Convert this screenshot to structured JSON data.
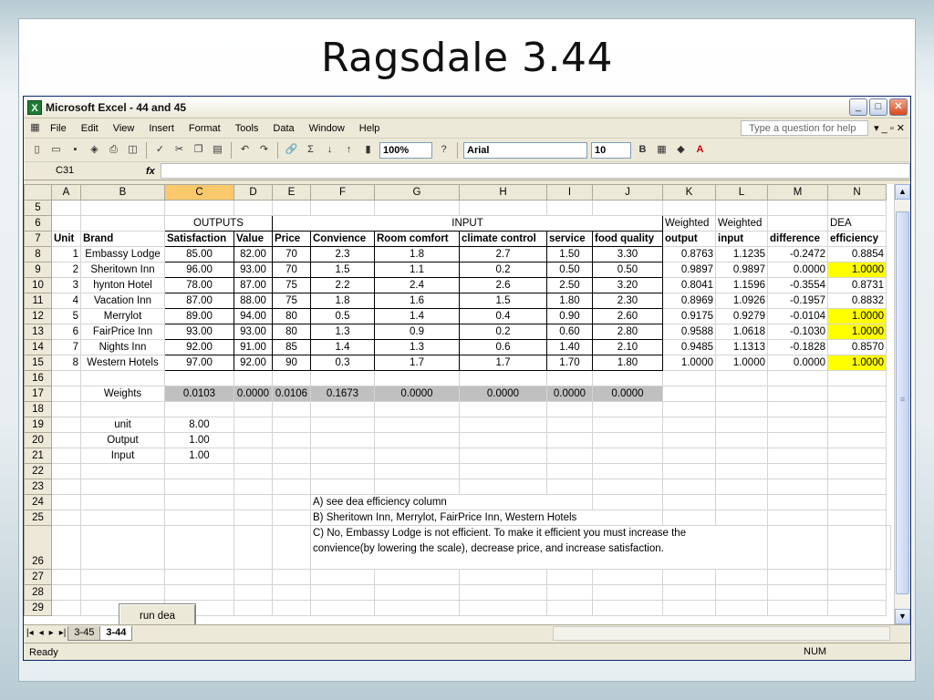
{
  "slide": {
    "title": "Ragsdale 3.44"
  },
  "window": {
    "title": "Microsoft Excel - 44 and 45"
  },
  "menu": [
    "File",
    "Edit",
    "View",
    "Insert",
    "Format",
    "Tools",
    "Data",
    "Window",
    "Help"
  ],
  "question_box": "Type a question for help",
  "toolbar": {
    "zoom": "100%",
    "font": "Arial",
    "font_size": "10"
  },
  "formula_bar": {
    "cell_ref": "C31",
    "fx": "fx",
    "formula": ""
  },
  "columns": [
    "A",
    "B",
    "C",
    "D",
    "E",
    "F",
    "G",
    "H",
    "I",
    "J",
    "K",
    "L",
    "M",
    "N"
  ],
  "rows": {
    "r5": {
      "n": "5"
    },
    "r6": {
      "n": "6",
      "outputs": "OUTPUTS",
      "input": "INPUT",
      "k": "Weighted",
      "l": "Weighted",
      "n_dea": "DEA"
    },
    "r7": {
      "n": "7",
      "cells": [
        "Unit",
        "Brand",
        "Satisfaction",
        "Value",
        "Price",
        "Convience",
        "Room comfort",
        "climate control",
        "service",
        "food quality",
        "output",
        "input",
        "difference",
        "efficiency"
      ]
    },
    "r8": {
      "n": "8",
      "cells": [
        "1",
        "Embassy Lodge",
        "85.00",
        "82.00",
        "70",
        "2.3",
        "1.8",
        "2.7",
        "1.50",
        "3.30",
        "0.8763",
        "1.1235",
        "-0.2472",
        "0.8854"
      ]
    },
    "r9": {
      "n": "9",
      "cells": [
        "2",
        "Sheritown Inn",
        "96.00",
        "93.00",
        "70",
        "1.5",
        "1.1",
        "0.2",
        "0.50",
        "0.50",
        "0.9897",
        "0.9897",
        "0.0000",
        "1.0000"
      ]
    },
    "r10": {
      "n": "10",
      "cells": [
        "3",
        "hynton Hotel",
        "78.00",
        "87.00",
        "75",
        "2.2",
        "2.4",
        "2.6",
        "2.50",
        "3.20",
        "0.8041",
        "1.1596",
        "-0.3554",
        "0.8731"
      ]
    },
    "r11": {
      "n": "11",
      "cells": [
        "4",
        "Vacation Inn",
        "87.00",
        "88.00",
        "75",
        "1.8",
        "1.6",
        "1.5",
        "1.80",
        "2.30",
        "0.8969",
        "1.0926",
        "-0.1957",
        "0.8832"
      ]
    },
    "r12": {
      "n": "12",
      "cells": [
        "5",
        "Merrylot",
        "89.00",
        "94.00",
        "80",
        "0.5",
        "1.4",
        "0.4",
        "0.90",
        "2.60",
        "0.9175",
        "0.9279",
        "-0.0104",
        "1.0000"
      ]
    },
    "r13": {
      "n": "13",
      "cells": [
        "6",
        "FairPrice Inn",
        "93.00",
        "93.00",
        "80",
        "1.3",
        "0.9",
        "0.2",
        "0.60",
        "2.80",
        "0.9588",
        "1.0618",
        "-0.1030",
        "1.0000"
      ]
    },
    "r14": {
      "n": "14",
      "cells": [
        "7",
        "Nights Inn",
        "92.00",
        "91.00",
        "85",
        "1.4",
        "1.3",
        "0.6",
        "1.40",
        "2.10",
        "0.9485",
        "1.1313",
        "-0.1828",
        "0.8570"
      ]
    },
    "r15": {
      "n": "15",
      "cells": [
        "8",
        "Western Hotels",
        "97.00",
        "92.00",
        "90",
        "0.3",
        "1.7",
        "1.7",
        "1.70",
        "1.80",
        "1.0000",
        "1.0000",
        "0.0000",
        "1.0000"
      ]
    },
    "r16": {
      "n": "16"
    },
    "r17": {
      "n": "17",
      "label": "Weights",
      "cells": [
        "0.0103",
        "0.0000",
        "0.0106",
        "0.1673",
        "0.0000",
        "0.0000",
        "0.0000",
        "0.0000"
      ]
    },
    "r18": {
      "n": "18"
    },
    "r19": {
      "n": "19",
      "label": "unit",
      "value": "8.00"
    },
    "r20": {
      "n": "20",
      "label": "Output",
      "value": "1.00"
    },
    "r21": {
      "n": "21",
      "label": "Input",
      "value": "1.00"
    },
    "r22": {
      "n": "22"
    },
    "r23": {
      "n": "23"
    },
    "r24": {
      "n": "24",
      "text": "A)  see dea efficiency column"
    },
    "r25": {
      "n": "25",
      "text": "B) Sheritown Inn, Merrylot, FairPrice Inn, Western Hotels"
    },
    "r26": {
      "n": "26",
      "text1": "C) No, Embassy Lodge is not efficient. To make it efficient you must increase the",
      "text2": "convience(by lowering the scale), decrease price, and increase satisfaction."
    },
    "r27": {
      "n": "27"
    },
    "r28": {
      "n": "28"
    },
    "r29": {
      "n": "29"
    }
  },
  "run_button": "run dea",
  "tabs": [
    "3-45",
    "3-44"
  ],
  "status": {
    "left": "Ready",
    "num": "NUM"
  }
}
